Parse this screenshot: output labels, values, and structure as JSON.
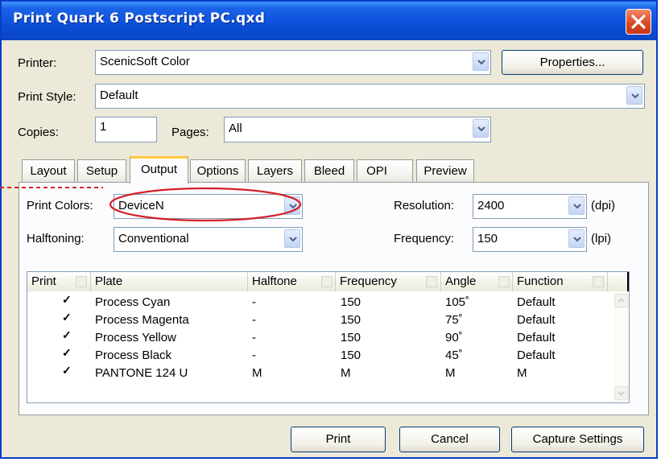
{
  "window": {
    "title": "Print Quark 6 Postscript PC.qxd"
  },
  "printer": {
    "label": "Printer:",
    "value": "ScenicSoft Color",
    "properties_button": "Properties..."
  },
  "print_style": {
    "label": "Print Style:",
    "value": "Default"
  },
  "copies": {
    "label": "Copies:",
    "value": "1"
  },
  "pages": {
    "label": "Pages:",
    "value": "All"
  },
  "tabs": [
    {
      "label": "Layout"
    },
    {
      "label": "Setup"
    },
    {
      "label": "Output",
      "active": true
    },
    {
      "label": "Options"
    },
    {
      "label": "Layers"
    },
    {
      "label": "Bleed"
    },
    {
      "label": "OPI"
    },
    {
      "label": "Preview"
    }
  ],
  "output": {
    "print_colors": {
      "label": "Print Colors:",
      "value": "DeviceN"
    },
    "halftoning": {
      "label": "Halftoning:",
      "value": "Conventional"
    },
    "resolution": {
      "label": "Resolution:",
      "value": "2400",
      "unit": "(dpi)"
    },
    "frequency": {
      "label": "Frequency:",
      "value": "150",
      "unit": "(lpi)"
    }
  },
  "plates_table": {
    "headers": [
      "Print",
      "Plate",
      "Halftone",
      "Frequency",
      "Angle",
      "Function"
    ],
    "rows": [
      {
        "print": "✓",
        "plate": "Process Cyan",
        "halftone": "-",
        "frequency": "150",
        "angle": "105˚",
        "function": "Default"
      },
      {
        "print": "✓",
        "plate": "Process Magenta",
        "halftone": "-",
        "frequency": "150",
        "angle": "75˚",
        "function": "Default"
      },
      {
        "print": "✓",
        "plate": "Process Yellow",
        "halftone": "-",
        "frequency": "150",
        "angle": "90˚",
        "function": "Default"
      },
      {
        "print": "✓",
        "plate": "Process Black",
        "halftone": "-",
        "frequency": "150",
        "angle": "45˚",
        "function": "Default"
      },
      {
        "print": "✓",
        "plate": "PANTONE 124 U",
        "halftone": "M",
        "frequency": "M",
        "angle": "M",
        "function": "M"
      }
    ]
  },
  "buttons": {
    "print": "Print",
    "cancel": "Cancel",
    "capture": "Capture Settings"
  },
  "annotation": {
    "color": "#d4202a"
  }
}
